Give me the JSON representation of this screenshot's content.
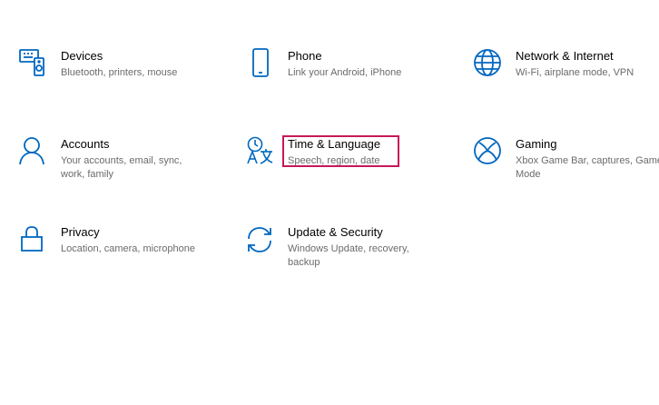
{
  "tiles": [
    {
      "key": "devices",
      "title": "Devices",
      "subtitle": "Bluetooth, printers, mouse",
      "icon": "devices-icon"
    },
    {
      "key": "phone",
      "title": "Phone",
      "subtitle": "Link your Android, iPhone",
      "icon": "phone-icon"
    },
    {
      "key": "network",
      "title": "Network & Internet",
      "subtitle": "Wi-Fi, airplane mode, VPN",
      "icon": "globe-icon"
    },
    {
      "key": "accounts",
      "title": "Accounts",
      "subtitle": "Your accounts, email, sync, work, family",
      "icon": "person-icon"
    },
    {
      "key": "time-language",
      "title": "Time & Language",
      "subtitle": "Speech, region, date",
      "icon": "time-language-icon"
    },
    {
      "key": "gaming",
      "title": "Gaming",
      "subtitle": "Xbox Game Bar, captures, Game Mode",
      "icon": "xbox-icon"
    },
    {
      "key": "privacy",
      "title": "Privacy",
      "subtitle": "Location, camera, microphone",
      "icon": "lock-icon"
    },
    {
      "key": "update-security",
      "title": "Update & Security",
      "subtitle": "Windows Update, recovery, backup",
      "icon": "sync-icon"
    }
  ],
  "colors": {
    "accent": "#0067c0",
    "highlight": "#c8185a",
    "subtitle": "#6b6b6b"
  },
  "selected_tile": "time-language"
}
